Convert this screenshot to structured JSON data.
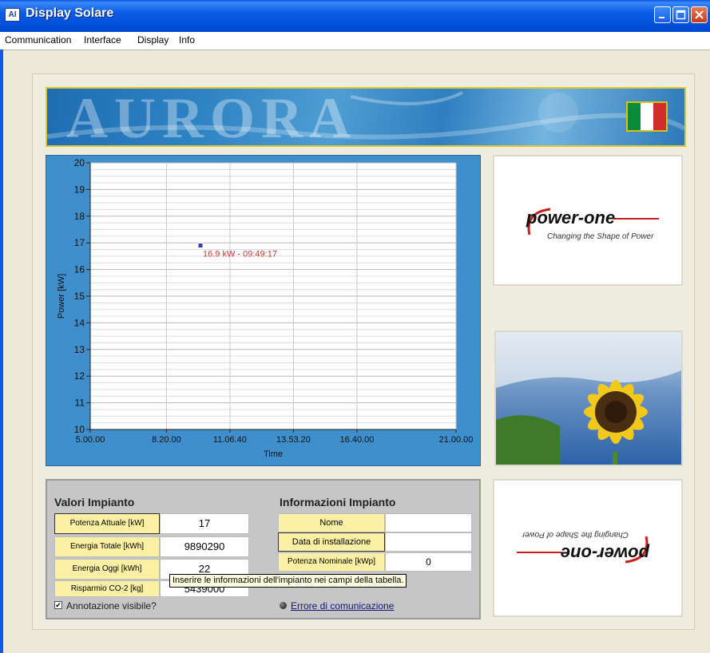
{
  "window": {
    "title": "Display Solare",
    "icon_name": "app-icon",
    "controls": [
      "minimize",
      "maximize",
      "close"
    ]
  },
  "menu": [
    "Communication",
    "Interface",
    "Display",
    "Info"
  ],
  "banner": {
    "text": "AURORA",
    "flag": "italy-flag"
  },
  "chart_data": {
    "type": "scatter",
    "xlabel": "Time",
    "ylabel": "Power [kW]",
    "x_tick_labels": [
      "5.00.00",
      "8.20.00",
      "11.06.40",
      "13.53.20",
      "16.40.00",
      "21.00.00"
    ],
    "x_ticks_hours": [
      5.0,
      8.333,
      11.111,
      13.889,
      16.667,
      21.0
    ],
    "xlim_hours": [
      5.0,
      21.0
    ],
    "y_ticks": [
      10,
      11,
      12,
      13,
      14,
      15,
      16,
      17,
      18,
      19,
      20
    ],
    "ylim": [
      10,
      20
    ],
    "grid": true,
    "points": [
      {
        "x_hours": 9.821,
        "y": 16.9
      }
    ],
    "annotation": "16.9 kW - 09:49:17"
  },
  "logos": {
    "top": {
      "brand": "power-one",
      "tagline": "Changing the Shape of Power"
    },
    "bottom": {
      "brand": "power-one",
      "tagline": "Changing the Shape of Power"
    }
  },
  "values_impianto": {
    "title": "Valori Impianto",
    "rows": [
      {
        "label": "Potenza Attuale [kW]",
        "value": "17"
      },
      {
        "label": "Energia Totale [kWh]",
        "value": "9890290"
      },
      {
        "label": "Energia Oggi [kWh]",
        "value": "22"
      },
      {
        "label": "Risparmio CO-2 [kg]",
        "value": "5439000"
      }
    ]
  },
  "info_impianto": {
    "title": "Informazioni Impianto",
    "rows": [
      {
        "label": "Nome",
        "value": ""
      },
      {
        "label": "Data di installazione",
        "value": ""
      },
      {
        "label": "Potenza Nominale [kWp]",
        "value": "0"
      }
    ]
  },
  "tooltip": "Inserire le informazioni dell'impianto nei campi della tabella.",
  "annotation_checkbox": {
    "label": "Annotazione visibile?",
    "checked": true
  },
  "comm_error": {
    "label": "Errore di comunicazione",
    "led_on": false
  }
}
